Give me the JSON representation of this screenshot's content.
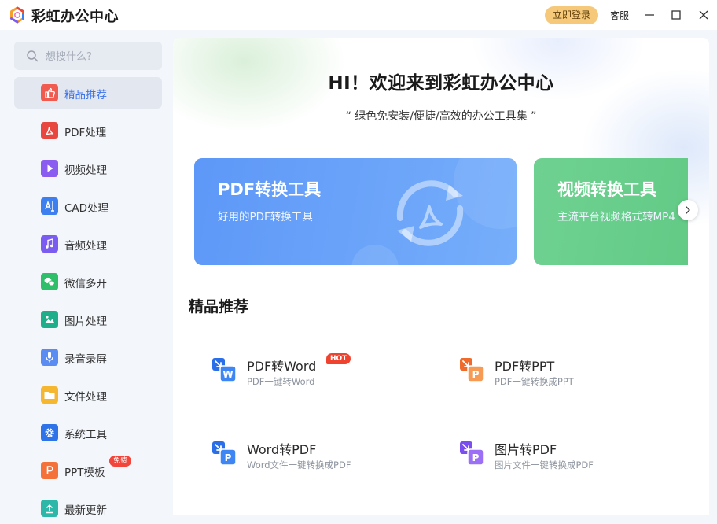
{
  "app": {
    "title": "彩虹办公中心"
  },
  "titlebar": {
    "login_label": "立即登录",
    "service_label": "客服"
  },
  "search": {
    "placeholder": "想搜什么?"
  },
  "sidebar": {
    "items": [
      {
        "label": "精品推荐",
        "icon": "thumbs-up-icon",
        "color": "#f05a4f"
      },
      {
        "label": "PDF处理",
        "icon": "pdf-icon",
        "color": "#e8473f"
      },
      {
        "label": "视频处理",
        "icon": "play-icon",
        "color": "#8a5cf0"
      },
      {
        "label": "CAD处理",
        "icon": "cad-icon",
        "color": "#3e7ff0"
      },
      {
        "label": "音频处理",
        "icon": "music-note-icon",
        "color": "#7b5cf0"
      },
      {
        "label": "微信多开",
        "icon": "wechat-icon",
        "color": "#2fbe6a"
      },
      {
        "label": "图片处理",
        "icon": "image-icon",
        "color": "#1fae8a"
      },
      {
        "label": "录音录屏",
        "icon": "microphone-icon",
        "color": "#5b8cf2"
      },
      {
        "label": "文件处理",
        "icon": "folder-icon",
        "color": "#f5b630"
      },
      {
        "label": "系统工具",
        "icon": "gear-icon",
        "color": "#2f73e8"
      },
      {
        "label": "PPT模板",
        "icon": "ppt-icon",
        "color": "#f4713a",
        "badge": "免费"
      },
      {
        "label": "最新更新",
        "icon": "upload-icon",
        "color": "#2cb7a9"
      }
    ]
  },
  "main": {
    "welcome": "HI！欢迎来到彩虹办公中心",
    "tagline": "“ 绿色免安装/便捷/高效的办公工具集 ”",
    "banners": [
      {
        "title": "PDF转换工具",
        "subtitle": "好用的PDF转换工具"
      },
      {
        "title": "视频转换工具",
        "subtitle": "主流平台视频格式转MP4"
      }
    ],
    "section_title": "精品推荐",
    "tools": [
      {
        "name": "PDF转Word",
        "desc": "PDF一键转Word",
        "badge": "HOT",
        "icon": "pdf-to-word-icon"
      },
      {
        "name": "PDF转PPT",
        "desc": "PDF一键转换成PPT",
        "icon": "pdf-to-ppt-icon"
      },
      {
        "name": "Word转PDF",
        "desc": "Word文件一键转换成PDF",
        "icon": "word-to-pdf-icon"
      },
      {
        "name": "图片转PDF",
        "desc": "图片文件一键转换成PDF",
        "icon": "image-to-pdf-icon"
      }
    ]
  },
  "colors": {
    "accent": "#3f74e8",
    "login": "#f6c97a",
    "hot": "#f0432f"
  }
}
